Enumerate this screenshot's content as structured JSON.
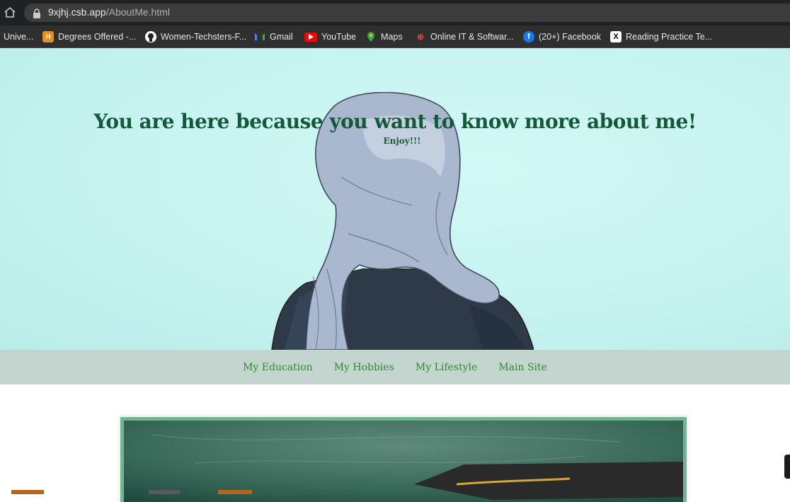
{
  "browser": {
    "url_host": "9xjhj.csb.app",
    "url_path": "/AboutMe.html",
    "bookmarks": [
      {
        "label": "Unive...",
        "icon": "university-icon"
      },
      {
        "label": "Degrees Offered -...",
        "icon": "degrees-icon"
      },
      {
        "label": "Women-Techsters-F...",
        "icon": "github-icon"
      },
      {
        "label": "Gmail",
        "icon": "gmail-icon"
      },
      {
        "label": "YouTube",
        "icon": "youtube-icon"
      },
      {
        "label": "Maps",
        "icon": "maps-icon"
      },
      {
        "label": "Online IT & Softwar...",
        "icon": "online-it-icon"
      },
      {
        "label": "(20+) Facebook",
        "icon": "facebook-icon"
      },
      {
        "label": "Reading Practice Te...",
        "icon": "x-icon"
      }
    ]
  },
  "hero": {
    "title": "You are here because you want to know more about me!",
    "subtitle": "Enjoy!!!"
  },
  "nav": {
    "items": [
      "My Education",
      "My Hobbies",
      "My Lifestyle",
      "Main Site"
    ]
  },
  "colors": {
    "hero_bg": "#c6f3f0",
    "title": "#145a3a",
    "nav_bg": "#c4d5d0",
    "nav_link": "#2e8b2e",
    "frame_border": "#6fb596"
  }
}
